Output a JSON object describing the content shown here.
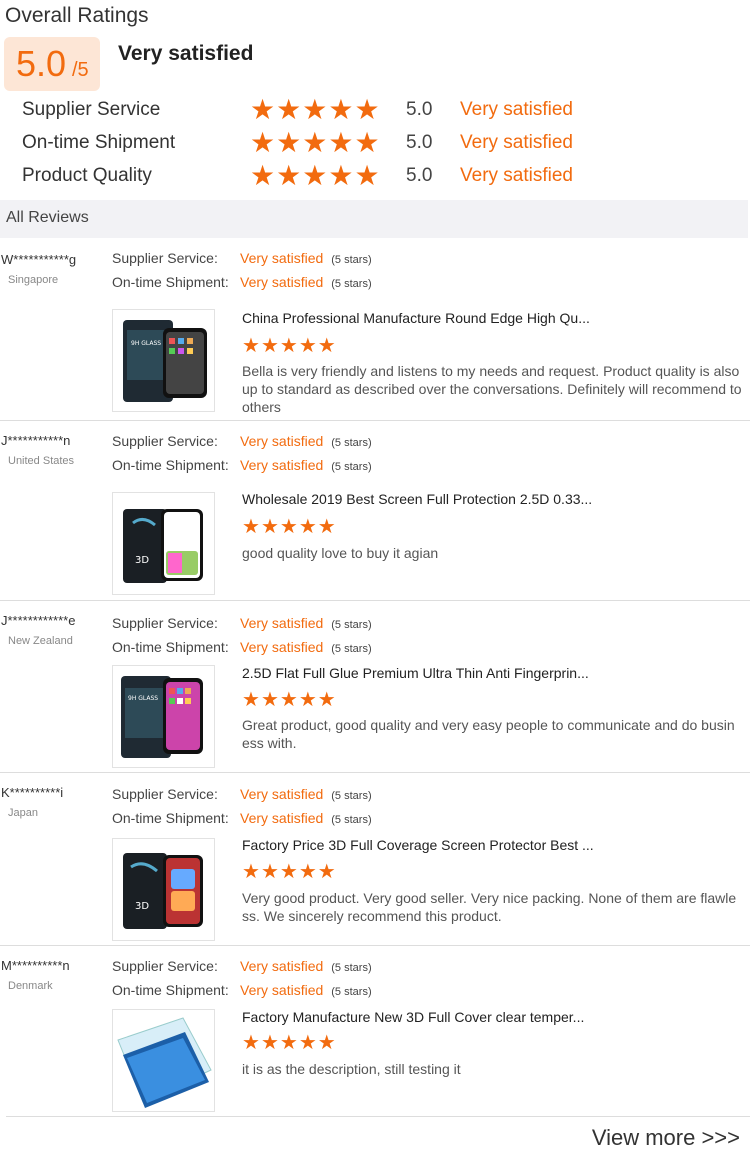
{
  "overall": {
    "title": "Overall Ratings",
    "score": "5.0",
    "score_max": "/5",
    "label": "Very satisfied"
  },
  "ratings": [
    {
      "name": "Supplier Service",
      "value": "5.0",
      "label": "Very satisfied",
      "stars": 5
    },
    {
      "name": "On-time Shipment",
      "value": "5.0",
      "label": "Very satisfied",
      "stars": 5
    },
    {
      "name": "Product Quality",
      "value": "5.0",
      "label": "Very satisfied",
      "stars": 5
    }
  ],
  "reviews_header": "All Reviews",
  "reviews": [
    {
      "user": "W***********g",
      "country": "Singapore",
      "service_label": "Supplier Service:",
      "service_value": "Very satisfied",
      "service_count": "(5 stars)",
      "shipment_label": "On-time Shipment:",
      "shipment_value": "Very satisfied",
      "shipment_count": "(5 stars)",
      "product": "China Professional Manufacture Round Edge High Qu...",
      "stars": 5,
      "comment": "Bella is very friendly and listens to my needs and request. Product quality is also up to standard as described over the conversations. Definitely will recommend to others"
    },
    {
      "user": "J***********n",
      "country": "United States",
      "service_label": "Supplier Service:",
      "service_value": "Very satisfied",
      "service_count": "(5 stars)",
      "shipment_label": "On-time Shipment:",
      "shipment_value": "Very satisfied",
      "shipment_count": "(5 stars)",
      "product": "Wholesale 2019 Best Screen Full Protection 2.5D 0.33...",
      "stars": 5,
      "comment": "good quality love to buy it agian"
    },
    {
      "user": "J************e",
      "country": "New Zealand",
      "service_label": "Supplier Service:",
      "service_value": "Very satisfied",
      "service_count": "(5 stars)",
      "shipment_label": "On-time Shipment:",
      "shipment_value": "Very satisfied",
      "shipment_count": "(5 stars)",
      "product": "2.5D Flat Full Glue Premium Ultra Thin Anti Fingerprin...",
      "stars": 5,
      "comment": "Great product, good quality and very easy people to communicate and do business with."
    },
    {
      "user": "K**********i",
      "country": "Japan",
      "service_label": "Supplier Service:",
      "service_value": "Very satisfied",
      "service_count": "(5 stars)",
      "shipment_label": "On-time Shipment:",
      "shipment_value": "Very satisfied",
      "shipment_count": "(5 stars)",
      "product": "Factory Price 3D Full Coverage Screen Protector Best ...",
      "stars": 5,
      "comment": "Very good product. Very good seller. Very nice packing. None of them are flawless. We sincerely recommend this product."
    },
    {
      "user": "M**********n",
      "country": "Denmark",
      "service_label": "Supplier Service:",
      "service_value": "Very satisfied",
      "service_count": "(5 stars)",
      "shipment_label": "On-time Shipment:",
      "shipment_value": "Very satisfied",
      "shipment_count": "(5 stars)",
      "product": "Factory Manufacture New 3D Full Cover clear temper...",
      "stars": 5,
      "comment": "it is as the description, still testing it"
    }
  ],
  "view_more": "View more >>>",
  "colors": {
    "accent": "#f26b0f",
    "score_bg": "#fde6d6",
    "header_bg": "#f2f2f5"
  },
  "icons": {
    "star": "star-icon"
  }
}
